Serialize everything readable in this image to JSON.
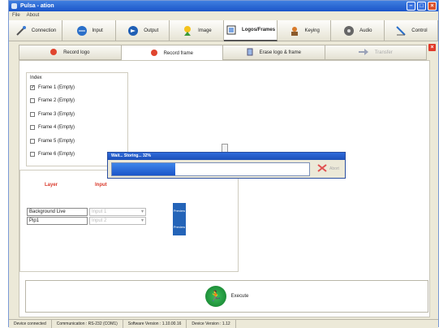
{
  "window": {
    "title": "Pulsa - ation"
  },
  "menu": [
    "File",
    "About"
  ],
  "main_tabs": [
    {
      "label": "Connection",
      "icon": "connection-icon"
    },
    {
      "label": "Input",
      "icon": "input-icon"
    },
    {
      "label": "Output",
      "icon": "output-icon"
    },
    {
      "label": "Image",
      "icon": "image-icon"
    },
    {
      "label": "Logos/Frames",
      "icon": "logos-frames-icon",
      "active": true
    },
    {
      "label": "Keying",
      "icon": "keying-icon"
    },
    {
      "label": "Audio",
      "icon": "audio-icon"
    },
    {
      "label": "Control",
      "icon": "control-icon"
    }
  ],
  "sub_tabs": [
    {
      "label": "Record logo",
      "icon": "record-dot-icon"
    },
    {
      "label": "Record frame",
      "icon": "record-dot-icon",
      "active": true
    },
    {
      "label": "Erase logo & frame",
      "icon": "erase-icon"
    },
    {
      "label": "Transfer",
      "icon": "transfer-arrow-icon",
      "disabled": true
    }
  ],
  "index": {
    "label": "Index",
    "frames": [
      {
        "label": "Frame 1 (Empty)",
        "checked": true
      },
      {
        "label": "Frame 2 (Empty)",
        "checked": false
      },
      {
        "label": "Frame 3 (Empty)",
        "checked": false
      },
      {
        "label": "Frame 4 (Empty)",
        "checked": false
      },
      {
        "label": "Frame 5 (Empty)",
        "checked": false
      },
      {
        "label": "Frame 6 (Empty)",
        "checked": false
      }
    ]
  },
  "layers": {
    "layer_header": "Layer",
    "input_header": "Input",
    "rows": [
      {
        "name": "Background Live",
        "input": "Input 1",
        "preview": "Preview"
      },
      {
        "name": "Pip1",
        "input": "Input 2",
        "preview": "Preview"
      }
    ]
  },
  "execute": {
    "label": "Execute"
  },
  "progress_dialog": {
    "title": "Wait... Storing... 32%",
    "progress": 0.32,
    "abort_label": "Abort"
  },
  "status": {
    "connection": "Device connected",
    "communication": "Communication : RS-232 (COM1)",
    "software": "Software Version : 1.10.00.16",
    "device": "Device Version : 1.12"
  },
  "colors": {
    "accent": "#1b55c9",
    "header_red": "#d9382a",
    "execute_green": "#1fa33f"
  }
}
